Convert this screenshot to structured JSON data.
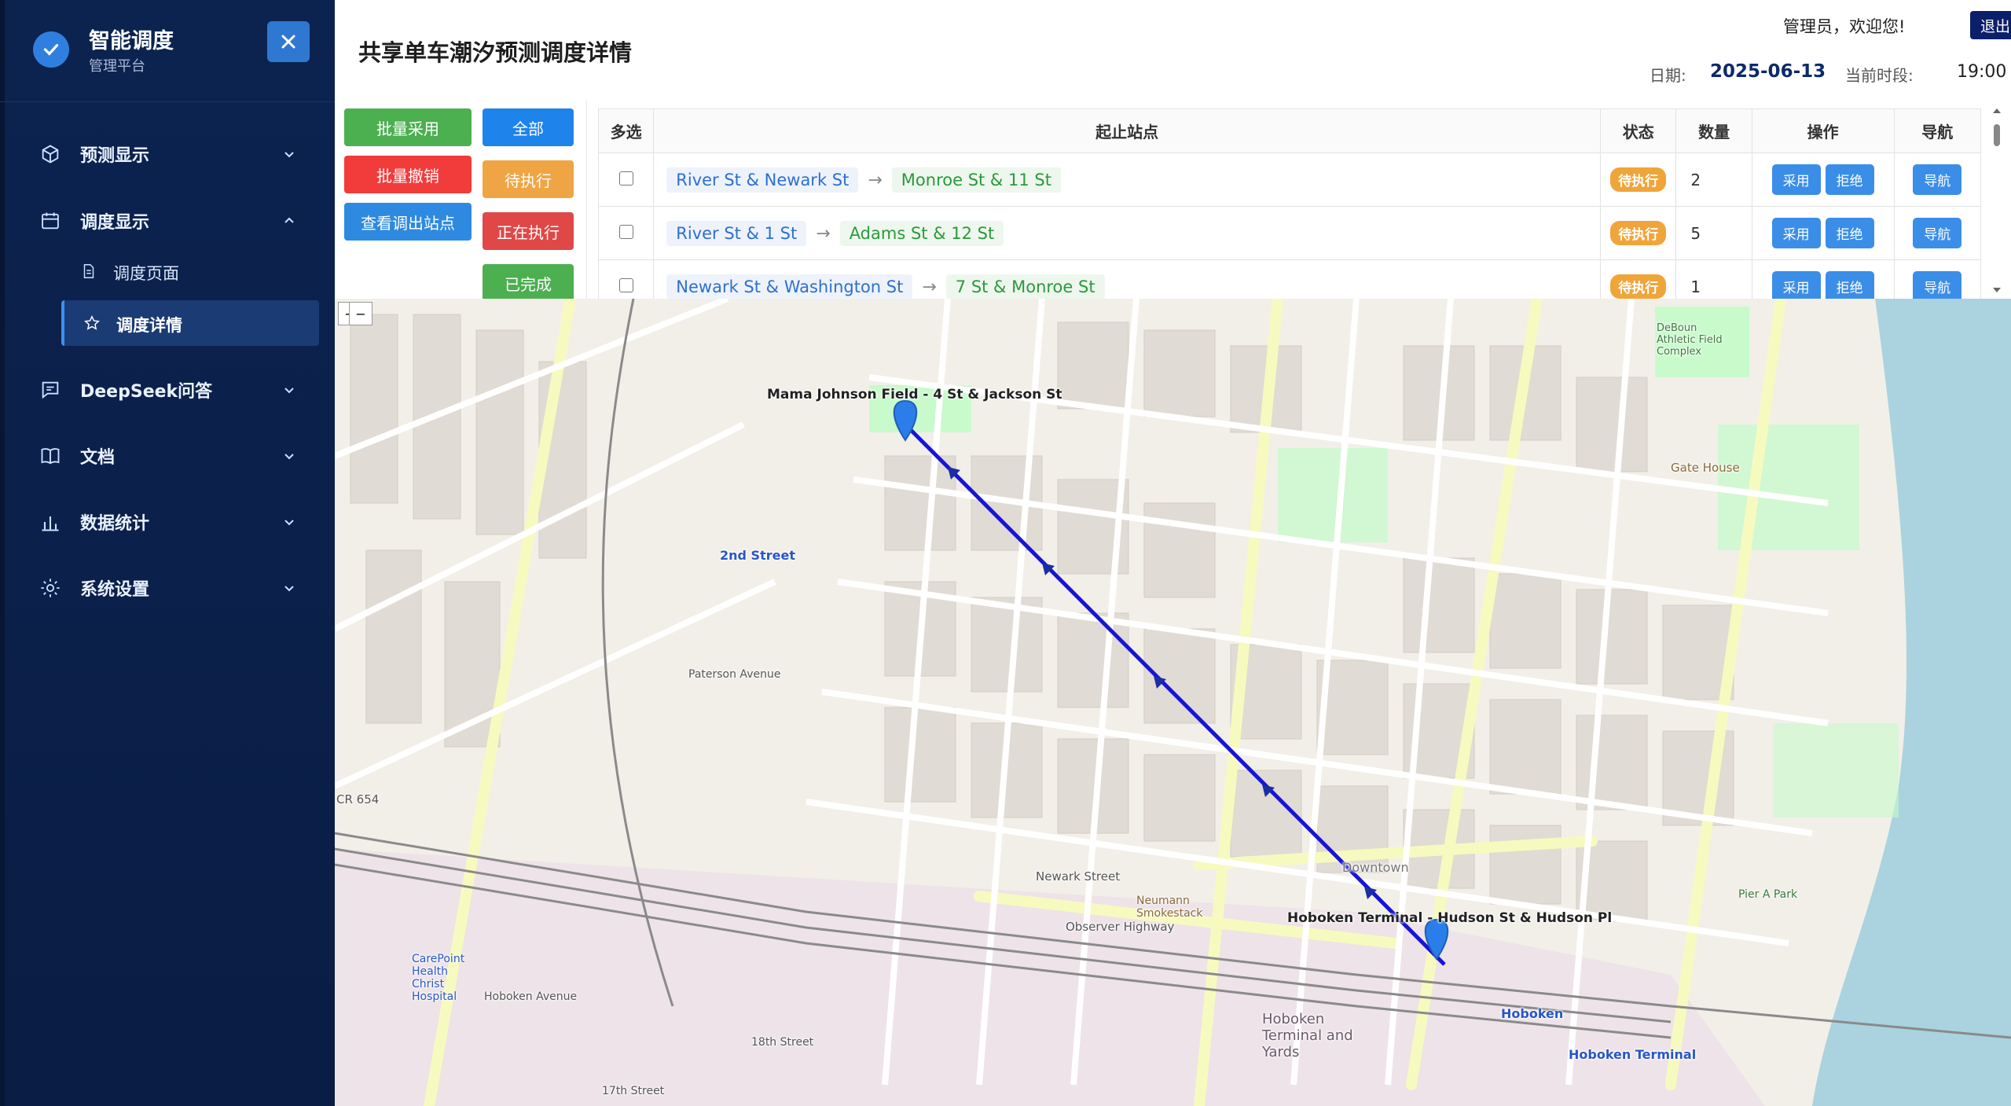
{
  "brand": {
    "title": "智能调度",
    "subtitle": "管理平台"
  },
  "sidebar": {
    "items": [
      {
        "label": "预测显示",
        "icon": "cube-icon"
      },
      {
        "label": "调度显示",
        "icon": "calendar-icon"
      },
      {
        "label": "DeepSeek问答",
        "icon": "chat-icon"
      },
      {
        "label": "文档",
        "icon": "book-icon"
      },
      {
        "label": "数据统计",
        "icon": "bar-chart-icon"
      },
      {
        "label": "系统设置",
        "icon": "gear-icon"
      }
    ],
    "subitems": [
      {
        "label": "调度页面",
        "icon": "document-icon"
      },
      {
        "label": "调度详情",
        "icon": "star-icon",
        "active": true
      }
    ]
  },
  "header": {
    "title": "共享单车潮汐预测调度详情",
    "welcome": "管理员，欢迎您!",
    "logout_label": "退出",
    "date_label": "日期:",
    "date_value": "2025-06-13",
    "period_label": "当前时段:",
    "period_value": "19:00"
  },
  "actions": {
    "bulk_accept": "批量采用",
    "bulk_revoke": "批量撤销",
    "view_out_stations": "查看调出站点",
    "filter_all": "全部",
    "filter_pending": "待执行",
    "filter_running": "正在执行",
    "filter_done": "已完成"
  },
  "table": {
    "headers": [
      "多选",
      "起止站点",
      "状态",
      "数量",
      "操作",
      "导航"
    ],
    "rows": [
      {
        "from": "River St & Newark St",
        "to": "Monroe St & 11 St",
        "status": "待执行",
        "count": "2"
      },
      {
        "from": "River St & 1 St",
        "to": "Adams St & 12 St",
        "status": "待执行",
        "count": "5"
      },
      {
        "from": "Newark St & Washington St",
        "to": "7 St & Monroe St",
        "status": "待执行",
        "count": "1"
      }
    ],
    "accept_label": "采用",
    "reject_label": "拒绝",
    "nav_label": "导航",
    "arrow": "→"
  },
  "map": {
    "origin_label": "Mama Johnson Field - 4 St & Jackson St",
    "destination_label": "Hoboken Terminal - Hudson St & Hudson Pl",
    "street_labels": [
      "2nd Street",
      "Observer Highway",
      "Newark Street",
      "Hoboken Terminal",
      "Hoboken",
      "Downtown",
      "Gate House",
      "CarePoint Health Christ Hospital",
      "Hoboken Terminal and Yards",
      "Pier A Park",
      "DeBoun Athletic Field Complex",
      "Neumann Smokestack",
      "CR 654",
      "Paterson Avenue",
      "Hoboken Avenue",
      "18th Street",
      "17th Street"
    ],
    "zoom_in": "+",
    "zoom_out": "−",
    "route_color": "#1515d8",
    "marker_color": "#2b7de9"
  }
}
